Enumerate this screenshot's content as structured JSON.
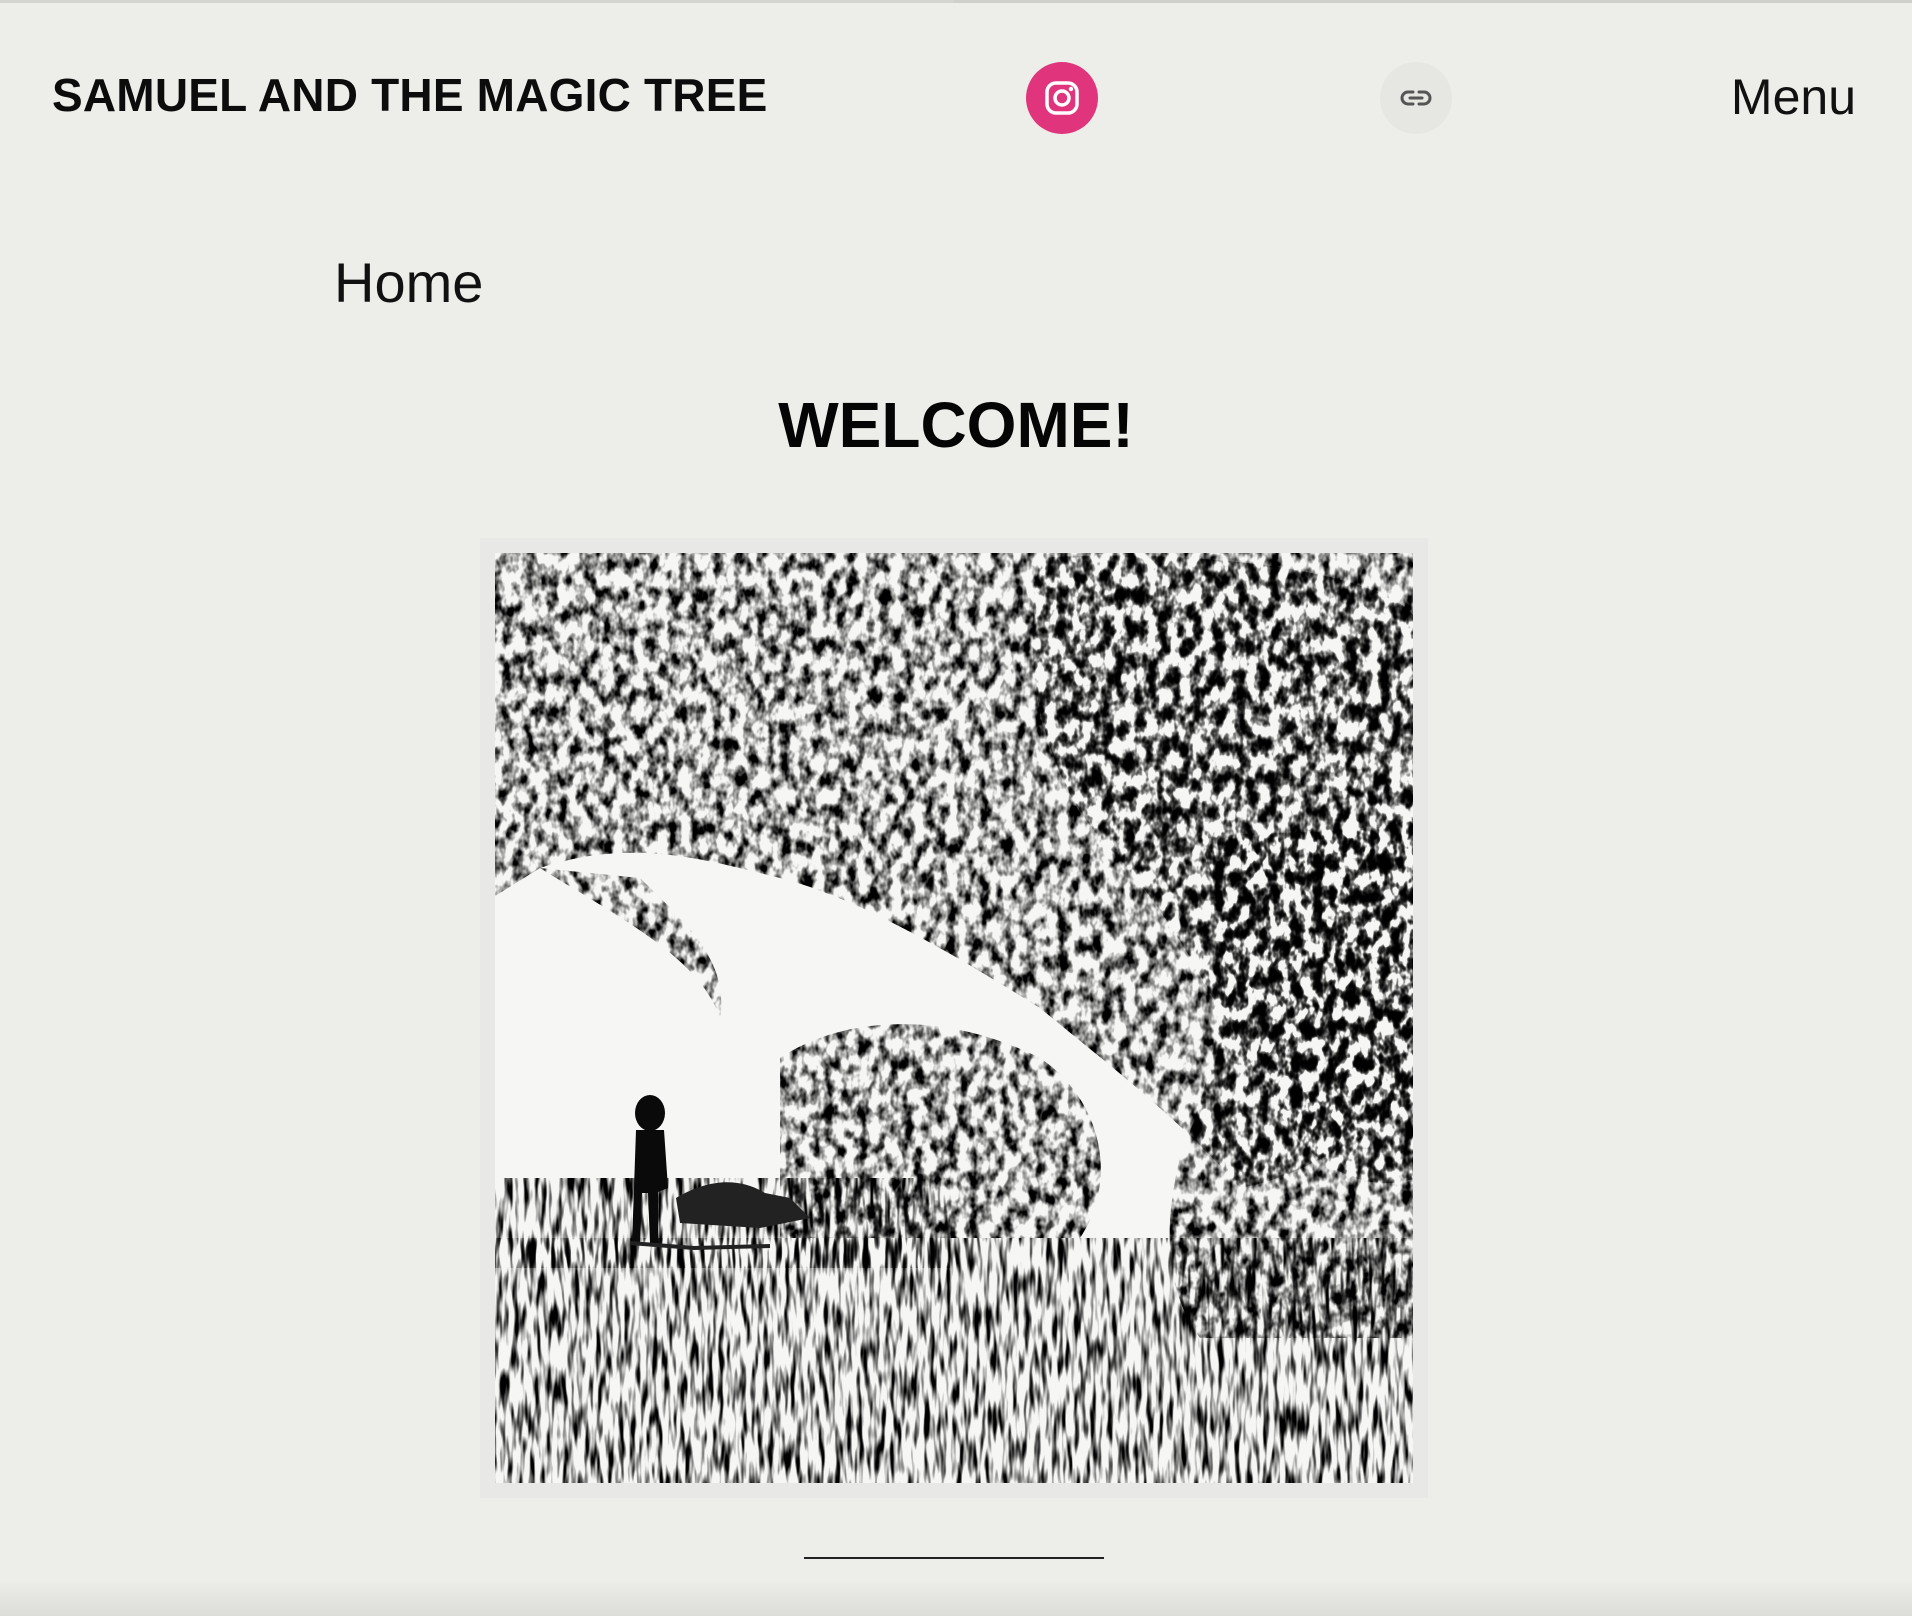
{
  "header": {
    "site_title": "SAMUEL AND THE MAGIC TREE",
    "instagram_icon": "instagram-icon",
    "instagram_color": "#e0357c",
    "link_icon": "link-icon",
    "menu_label": "Menu"
  },
  "nav": {
    "current_page": "Home"
  },
  "main": {
    "heading": "WELCOME!",
    "hero_image_subject": "black-and-white sketch of a child standing beneath a large tree"
  },
  "colors": {
    "background": "#edede9",
    "text": "#111111"
  }
}
